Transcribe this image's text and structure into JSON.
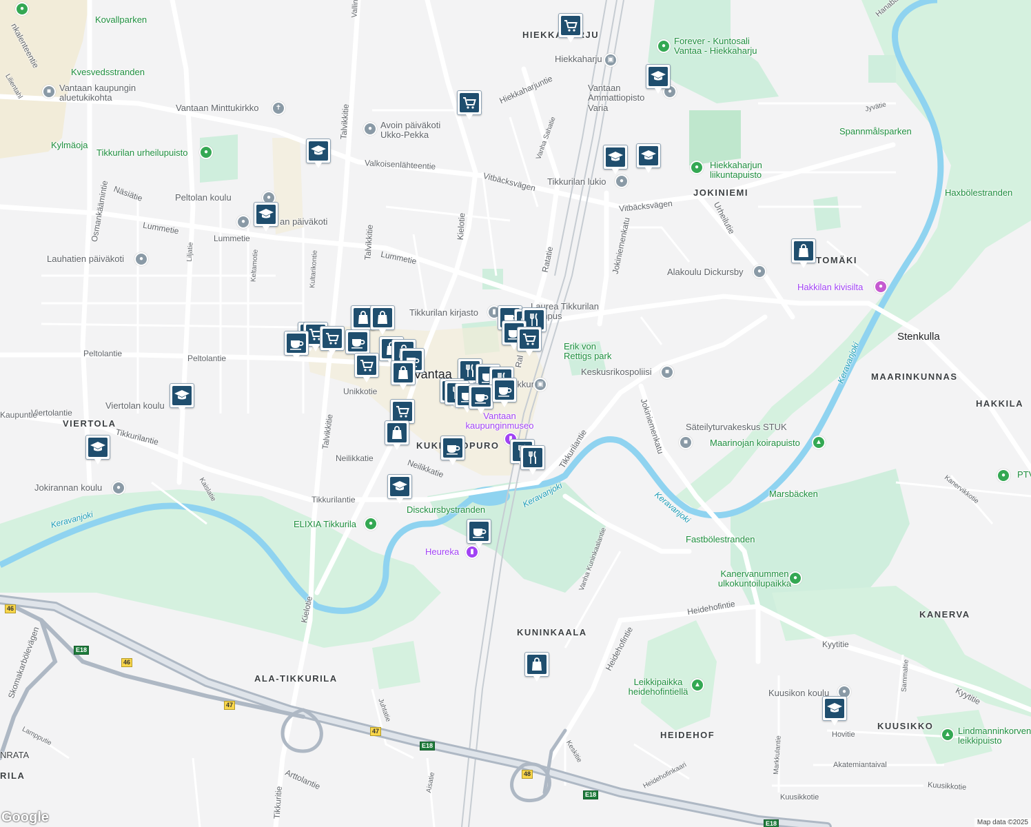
{
  "map": {
    "districts": [
      "HIEKKAHARJU",
      "JOKINIEMI",
      "VIERTOLA",
      "KUKKAROPURO",
      "MAARINKUNNAS",
      "HAKKILA",
      "KANERVA",
      "KUNINKAALA",
      "ALA-TIKKURILA",
      "HEIDEHOF",
      "KUUSIKKO",
      "TOMÄKI",
      "RILA",
      "NRATA"
    ],
    "places": [
      "Stenkulla",
      "Vantaa"
    ],
    "parks": [
      "Kovallparken",
      "Kvesvedsstranden",
      "Kylmäoja",
      "Tikkurilan urheilupuisto",
      "Forever - Kuntosali Vantaa - Hiekkaharju",
      "Spannmålsparken",
      "Hiekkaharjun liikuntapuisto",
      "Haxbölestranden",
      "Erik von Rettigs park",
      "Maarinojan koirapuisto",
      "Marsbäcken",
      "Fastbölestranden",
      "Kanervanummen ulkokuntoilupaikka",
      "ELIXIA Tikkurila",
      "Disckursbystranden",
      "Leikkipaikka heidehofintiellä",
      "Lindmanninkorven leikkipuisto",
      "PTV"
    ],
    "pois": [
      "Vantaan kaupungin aluetukikohta",
      "Vantaan Minttukirkko",
      "Avoin päiväkoti Ukko-Pekka",
      "Peltolan koulu",
      "an päiväkoti",
      "Lauhatien päiväkoti",
      "Tikkurilan kirjasto",
      "Laurea Tikkurilan kampus",
      "Tikkurilan lukio",
      "Vantaan Ammattiopisto Varia",
      "Alakoulu Dickursby",
      "Keskusrikospoliisi",
      "Säteilyturvakeskus STUK",
      "Viertolan koulu",
      "Jokirannan koulu",
      "Kuusikon koulu",
      "Hiekkaharju",
      "Tikkurila"
    ],
    "museum_pois": [
      "Vantaan kaupunginmuseo",
      "Heureka",
      "Hakkilan kivisilta"
    ],
    "water": [
      "Keravanjoki",
      "Keravanjoki",
      "Keravanjoki",
      "Keravanjoki"
    ],
    "roads": [
      "Valkoisenlähteentie",
      "Vitbäcksvägen",
      "Vitbäcksvägen",
      "Lummetie",
      "Lummetie",
      "Lummetie",
      "Peltolantie",
      "Peltolantie",
      "Unikkotie",
      "Viertolantie",
      "Tikkurilantie",
      "Tikkurilantie",
      "Tikkurilantie",
      "Neilikkatie",
      "Neilikkatie",
      "Talvikkitie",
      "Talvikkitie",
      "Talvikkitie",
      "Kielotie",
      "Kielotie",
      "Hiekkaharjuntie",
      "Jokiniemenkatu",
      "Jokiniemenkatu",
      "Urheilutie",
      "Ratatie",
      "Heidehofintie",
      "Heidehofintie",
      "Kyytitie",
      "Kyytitie",
      "Osmankäämintie",
      "Näsiätie",
      "Keltamotie",
      "Kultarikontie",
      "Liljatie",
      "Kaislatie",
      "Skomakarbölevägen",
      "Lampputie",
      "Arttolantie",
      "Juhtatie",
      "Aisatie",
      "Tikkuritie",
      "Vanha Kuninkaalantie",
      "Keskitie",
      "Heidehofinkaari",
      "Markkulantie",
      "Sammaltie",
      "Hovitie",
      "Akatemiantaival",
      "Kuusikkotie",
      "Kuusikkotie",
      "Kanervikkotie",
      "Vanha Sahatie",
      "Jyvätie",
      "Hanaba",
      "Vallinte",
      "Lilientahl",
      "Ral",
      "Kaupuntie",
      "nkalenteentie"
    ],
    "shields": [
      "46",
      "46",
      "47",
      "47",
      "48",
      "E18",
      "E18",
      "E18",
      "E18"
    ],
    "footer": {
      "logo": "Google",
      "attribution": "Map data ©2025"
    },
    "colors": {
      "background": "#f3f3f4",
      "park": "#cfeedd",
      "water": "#8fd3f0",
      "road": "#ffffff",
      "highway": "#aeb8c4",
      "marker_fill": "#1f4e6e",
      "poi_green": "#34a853",
      "poi_gray": "#8a9aa6",
      "poi_purple": "#a142f4"
    }
  }
}
